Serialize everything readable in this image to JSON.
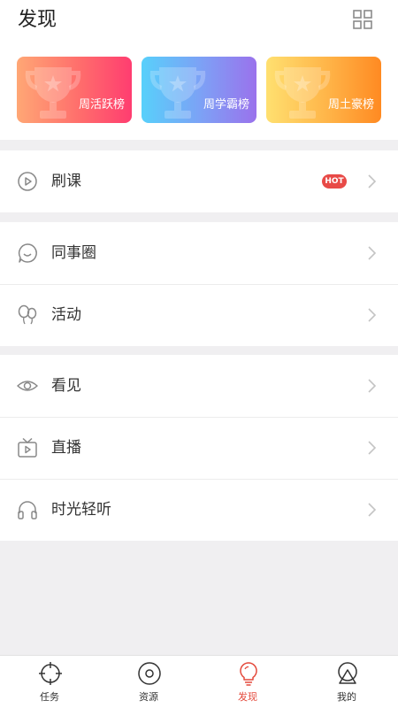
{
  "header": {
    "title": "发现"
  },
  "leaderboards": [
    {
      "label": "周活跃榜"
    },
    {
      "label": "周学霸榜"
    },
    {
      "label": "周土豪榜"
    }
  ],
  "sections": {
    "courses": {
      "label": "刷课",
      "badge": "HOT"
    },
    "colleagues": {
      "label": "同事圈"
    },
    "activity": {
      "label": "活动"
    },
    "seeing": {
      "label": "看见"
    },
    "live": {
      "label": "直播"
    },
    "listen": {
      "label": "时光轻听"
    }
  },
  "tabbar": {
    "tasks": "任务",
    "resources": "资源",
    "discover": "发现",
    "mine": "我的",
    "active_color": "#e4493b"
  }
}
